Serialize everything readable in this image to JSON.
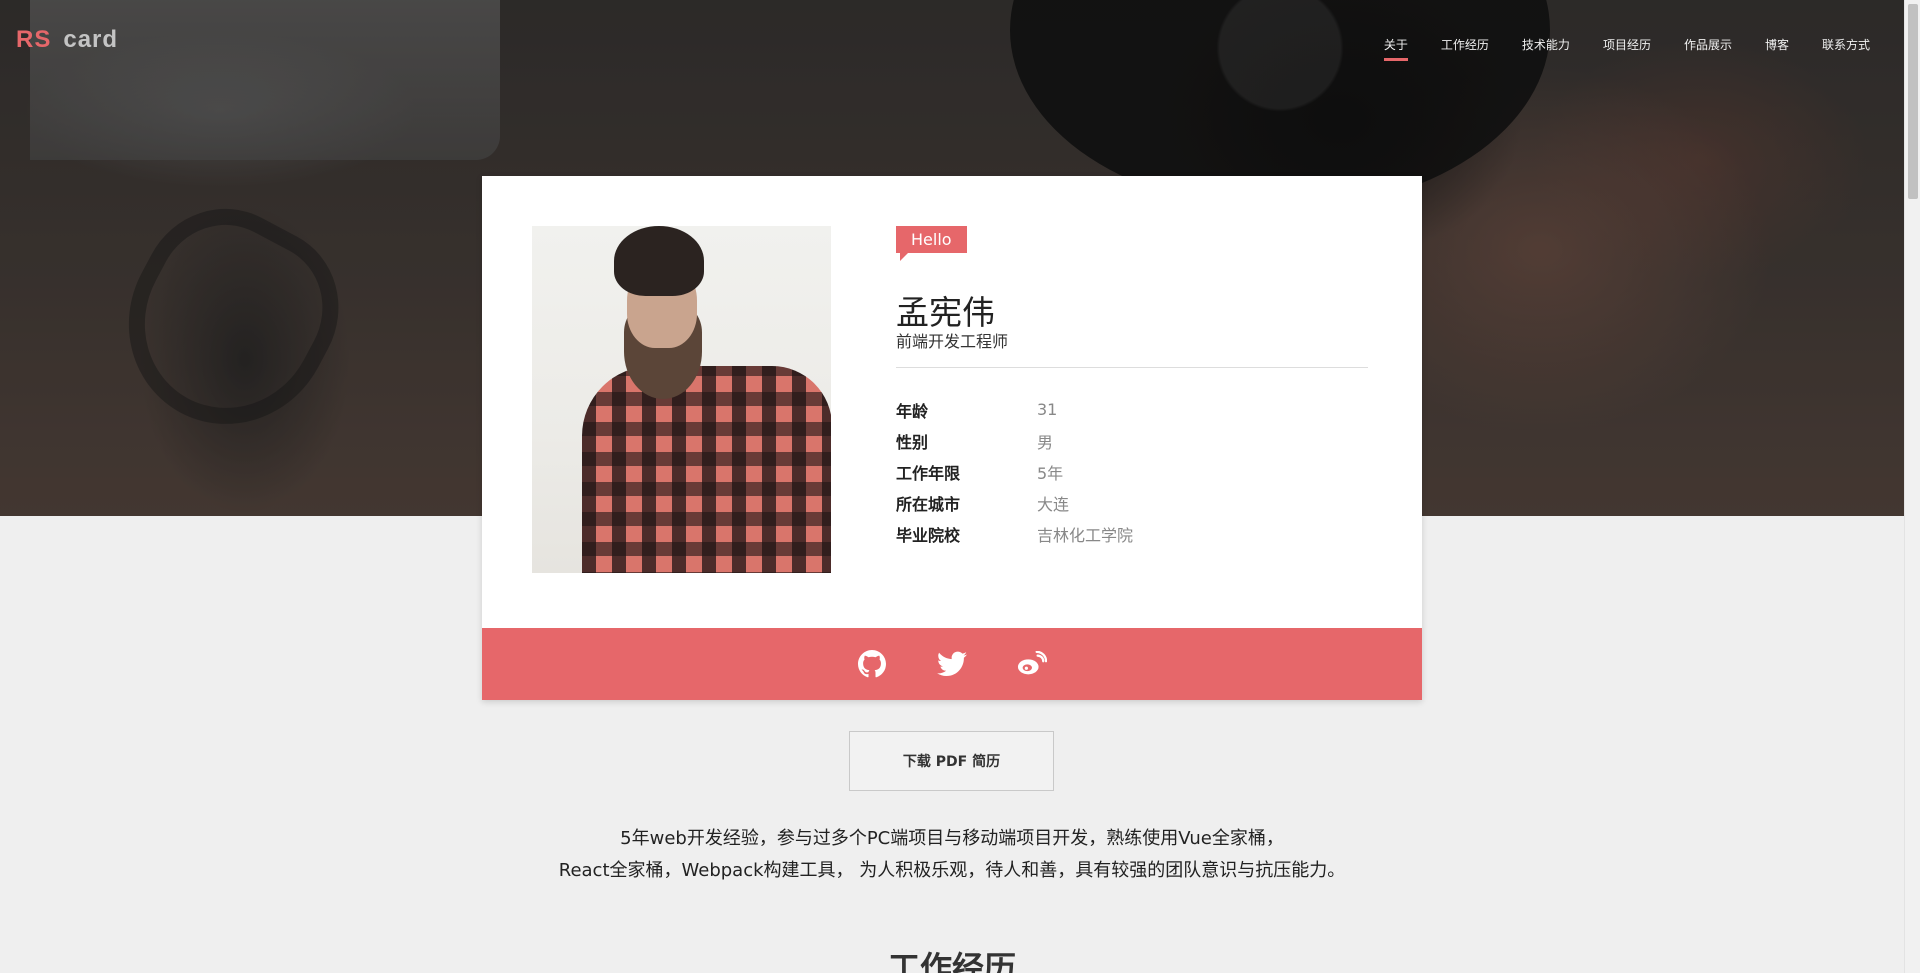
{
  "header": {
    "logo_rs": "RS",
    "logo_card": "card",
    "nav": [
      {
        "label": "关于",
        "active": true
      },
      {
        "label": "工作经历",
        "active": false
      },
      {
        "label": "技术能力",
        "active": false
      },
      {
        "label": "项目经历",
        "active": false
      },
      {
        "label": "作品展示",
        "active": false
      },
      {
        "label": "博客",
        "active": false
      },
      {
        "label": "联系方式",
        "active": false
      }
    ]
  },
  "profile": {
    "greeting": "Hello",
    "name": "孟宪伟",
    "role": "前端开发工程师",
    "info": [
      {
        "key": "年龄",
        "value": "31"
      },
      {
        "key": "性别",
        "value": "男"
      },
      {
        "key": "工作年限",
        "value": "5年"
      },
      {
        "key": "所在城市",
        "value": "大连"
      },
      {
        "key": "毕业院校",
        "value": "吉林化工学院"
      }
    ],
    "social": [
      "github-icon",
      "twitter-icon",
      "weibo-icon"
    ]
  },
  "download_label": "下载 PDF 简历",
  "summary": {
    "line1": "5年web开发经验，参与过多个PC端项目与移动端项目开发，熟练使用Vue全家桶，",
    "line2": "React全家桶，Webpack构建工具， 为人积极乐观，待人和善，具有较强的团队意识与抗压能力。"
  },
  "section_title": "工作经历",
  "colors": {
    "accent": "#e6676a",
    "background": "#efefef"
  }
}
